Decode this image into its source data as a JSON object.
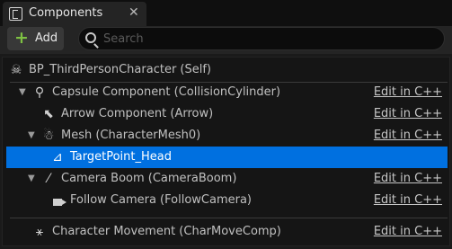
{
  "window": {
    "tab_title": "Components",
    "close_glyph": "✕"
  },
  "toolbar": {
    "add_label": "Add",
    "add_icon": "plus-icon",
    "search_placeholder": "Search"
  },
  "tree": {
    "root": {
      "label": "BP_ThirdPersonCharacter (Self)",
      "icon": "actor-icon"
    },
    "items": [
      {
        "label": "Capsule Component (CollisionCylinder)",
        "icon": "capsule-icon",
        "expanded": true,
        "edit": "Edit in C++"
      },
      {
        "label": "Arrow Component (Arrow)",
        "icon": "arrow-icon",
        "edit": "Edit in C++"
      },
      {
        "label": "Mesh (CharacterMesh0)",
        "icon": "skeletal-mesh-icon",
        "expanded": true,
        "edit": "Edit in C++"
      },
      {
        "label": "TargetPoint_Head",
        "icon": "target-point-icon",
        "selected": true
      },
      {
        "label": "Camera Boom (CameraBoom)",
        "icon": "spring-arm-icon",
        "expanded": true,
        "edit": "Edit in C++"
      },
      {
        "label": "Follow Camera (FollowCamera)",
        "icon": "camera-icon",
        "edit": "Edit in C++"
      },
      {
        "label": "Character Movement (CharMoveComp)",
        "icon": "character-movement-icon",
        "edit": "Edit in C++"
      }
    ]
  },
  "colors": {
    "selection": "#0070e0",
    "add_plus": "#7ec143",
    "background": "#151515"
  }
}
